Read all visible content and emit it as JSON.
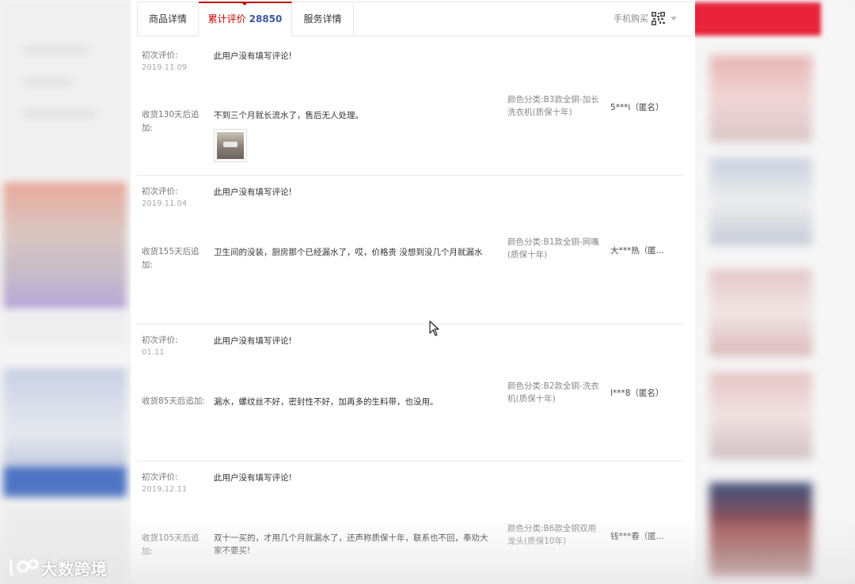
{
  "tabs": {
    "product_details": "商品详情",
    "reviews_label": "累计评价",
    "reviews_count": "28850",
    "service_details": "服务详情"
  },
  "mobile_buy": "手机购买",
  "colors": {
    "accent_red": "#c40000",
    "count_blue": "#3c5a9a",
    "red_banner": "#e8233a"
  },
  "reviews": [
    {
      "first_label": "初次评价:",
      "first_date": "2019.11.09",
      "first_text": "此用户没有填写评论!",
      "append_label": "收货130天后追加:",
      "append_text": "不到三个月就长流水了，售后无人处理。",
      "sku_key": "颜色分类:",
      "sku_value": "B3款全铜-加长洗衣机(质保十年)",
      "user": "5***i（匿名）",
      "has_photo": true
    },
    {
      "first_label": "初次评价:",
      "first_date": "2019.11.04",
      "first_text": "此用户没有填写评论!",
      "append_label": "收货155天后追加:",
      "append_text": "卫生间的没装，厨房那个已经漏水了，哎，价格贵 没想到没几个月就漏水",
      "sku_key": "颜色分类:",
      "sku_value": "B1款全铜-网嘴(质保十年)",
      "user": "大***热（匿...",
      "has_photo": false
    },
    {
      "first_label": "初次评价:",
      "first_date": "01.11",
      "first_text": "此用户没有填写评论!",
      "append_label": "收货85天后追加:",
      "append_text": "漏水，螺纹丝不好，密封性不好，加再多的生料带，也没用。",
      "sku_key": "颜色分类:",
      "sku_value": "B2款全铜-洗衣机(质保十年)",
      "user": "l***8（匿名）",
      "has_photo": false
    },
    {
      "first_label": "初次评价:",
      "first_date": "2019.12.11",
      "first_text": "此用户没有填写评论!",
      "append_label": "收货105天后追加:",
      "append_text": "双十一买的，才用几个月就漏水了，还声称质保十年，联系也不回，奉劝大家不要买!",
      "sku_key": "颜色分类:",
      "sku_value": "B6款全铜双用龙头(质保10年)",
      "user": "钱***春（匿...",
      "has_photo": false
    }
  ],
  "watermark": "大数跨境"
}
